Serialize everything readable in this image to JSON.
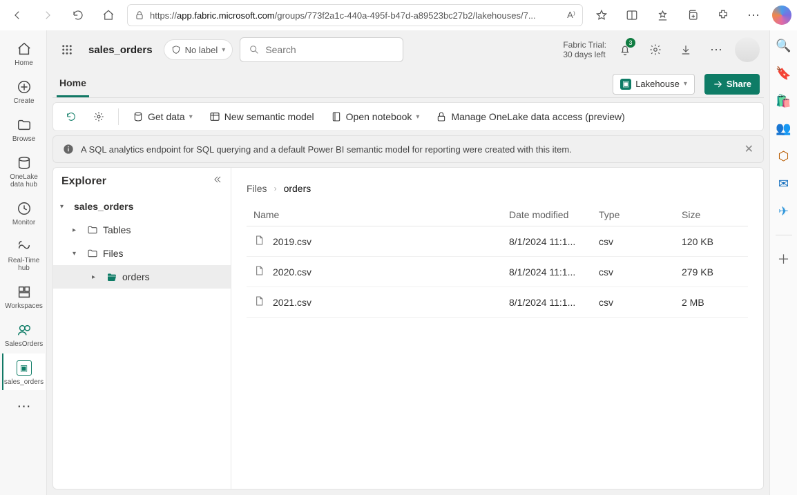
{
  "browser": {
    "url_prefix": "https://",
    "url_host": "app.fabric.microsoft.com",
    "url_rest": "/groups/773f2a1c-440a-495f-b47d-a89523bc27b2/lakehouses/7..."
  },
  "header": {
    "workspace": "sales_orders",
    "no_label": "No label",
    "search_placeholder": "Search",
    "trial_line1": "Fabric Trial:",
    "trial_line2": "30 days left",
    "notif_count": "3"
  },
  "tabs": {
    "home": "Home",
    "lakehouse": "Lakehouse",
    "share": "Share"
  },
  "toolbar": {
    "get_data": "Get data",
    "new_model": "New semantic model",
    "open_notebook": "Open notebook",
    "manage_access": "Manage OneLake data access (preview)"
  },
  "infobar": {
    "text": "A SQL analytics endpoint for SQL querying and a default Power BI semantic model for reporting were created with this item."
  },
  "nav": {
    "home": "Home",
    "create": "Create",
    "browse": "Browse",
    "onelake": "OneLake data hub",
    "monitor": "Monitor",
    "realtime": "Real-Time hub",
    "workspaces": "Workspaces",
    "salesorders": "SalesOrders",
    "sales_orders": "sales_orders"
  },
  "explorer": {
    "title": "Explorer",
    "root": "sales_orders",
    "tables": "Tables",
    "files": "Files",
    "orders": "orders"
  },
  "breadcrumb": {
    "files": "Files",
    "orders": "orders"
  },
  "columns": {
    "name": "Name",
    "date": "Date modified",
    "type": "Type",
    "size": "Size"
  },
  "files": [
    {
      "name": "2019.csv",
      "date": "8/1/2024 11:1...",
      "type": "csv",
      "size": "120 KB"
    },
    {
      "name": "2020.csv",
      "date": "8/1/2024 11:1...",
      "type": "csv",
      "size": "279 KB"
    },
    {
      "name": "2021.csv",
      "date": "8/1/2024 11:1...",
      "type": "csv",
      "size": "2 MB"
    }
  ]
}
